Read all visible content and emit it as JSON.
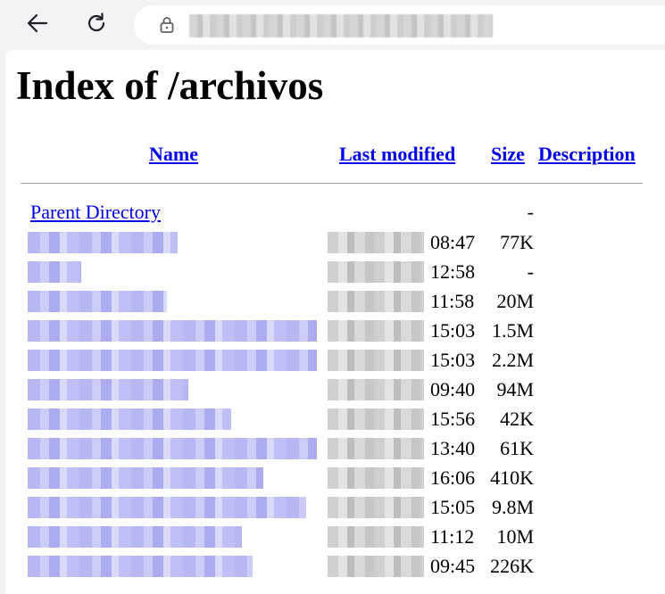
{
  "browser": {
    "back_icon": "arrow-left-icon",
    "reload_icon": "reload-icon",
    "lock_icon": "lock-icon"
  },
  "page": {
    "title": "Index of /archivos",
    "headers": {
      "name": "Name",
      "last_modified": "Last modified",
      "size": "Size",
      "description": "Description"
    },
    "parent": {
      "label": "Parent Directory",
      "size": "-"
    },
    "rows": [
      {
        "time": "08:47",
        "size": "77K"
      },
      {
        "time": "12:58",
        "size": "-"
      },
      {
        "time": "11:58",
        "size": "20M"
      },
      {
        "time": "15:03",
        "size": "1.5M"
      },
      {
        "time": "15:03",
        "size": "2.2M"
      },
      {
        "time": "09:40",
        "size": "94M"
      },
      {
        "time": "15:56",
        "size": "42K"
      },
      {
        "time": "13:40",
        "size": "61K"
      },
      {
        "time": "16:06",
        "size": "410K"
      },
      {
        "time": "15:05",
        "size": "9.8M"
      },
      {
        "time": "11:12",
        "size": "10M"
      },
      {
        "time": "09:45",
        "size": "226K"
      }
    ]
  },
  "colors": {
    "link": "#0000ee",
    "rule": "#a0a0a0",
    "toolbar": "#f1f3f4"
  }
}
